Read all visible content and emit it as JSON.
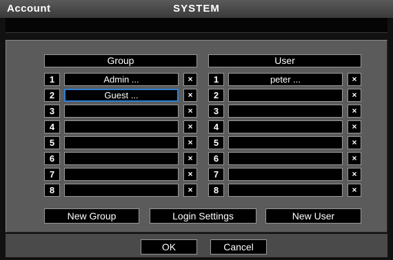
{
  "window": {
    "left_title": "Account",
    "center_title": "SYSTEM"
  },
  "group": {
    "header": "Group",
    "rows": [
      {
        "num": "1",
        "value": "Admin ..."
      },
      {
        "num": "2",
        "value": "Guest ..."
      },
      {
        "num": "3",
        "value": ""
      },
      {
        "num": "4",
        "value": ""
      },
      {
        "num": "5",
        "value": ""
      },
      {
        "num": "6",
        "value": ""
      },
      {
        "num": "7",
        "value": ""
      },
      {
        "num": "8",
        "value": ""
      }
    ],
    "delete_glyph": "×"
  },
  "user": {
    "header": "User",
    "rows": [
      {
        "num": "1",
        "value": "peter ..."
      },
      {
        "num": "2",
        "value": ""
      },
      {
        "num": "3",
        "value": ""
      },
      {
        "num": "4",
        "value": ""
      },
      {
        "num": "5",
        "value": ""
      },
      {
        "num": "6",
        "value": ""
      },
      {
        "num": "7",
        "value": ""
      },
      {
        "num": "8",
        "value": ""
      }
    ],
    "delete_glyph": "×"
  },
  "actions": {
    "new_group": "New Group",
    "login_settings": "Login Settings",
    "new_user": "New User"
  },
  "footer": {
    "ok": "OK",
    "cancel": "Cancel"
  },
  "colors": {
    "selection": "#2e7fd6",
    "panel": "#5b5b5b"
  }
}
